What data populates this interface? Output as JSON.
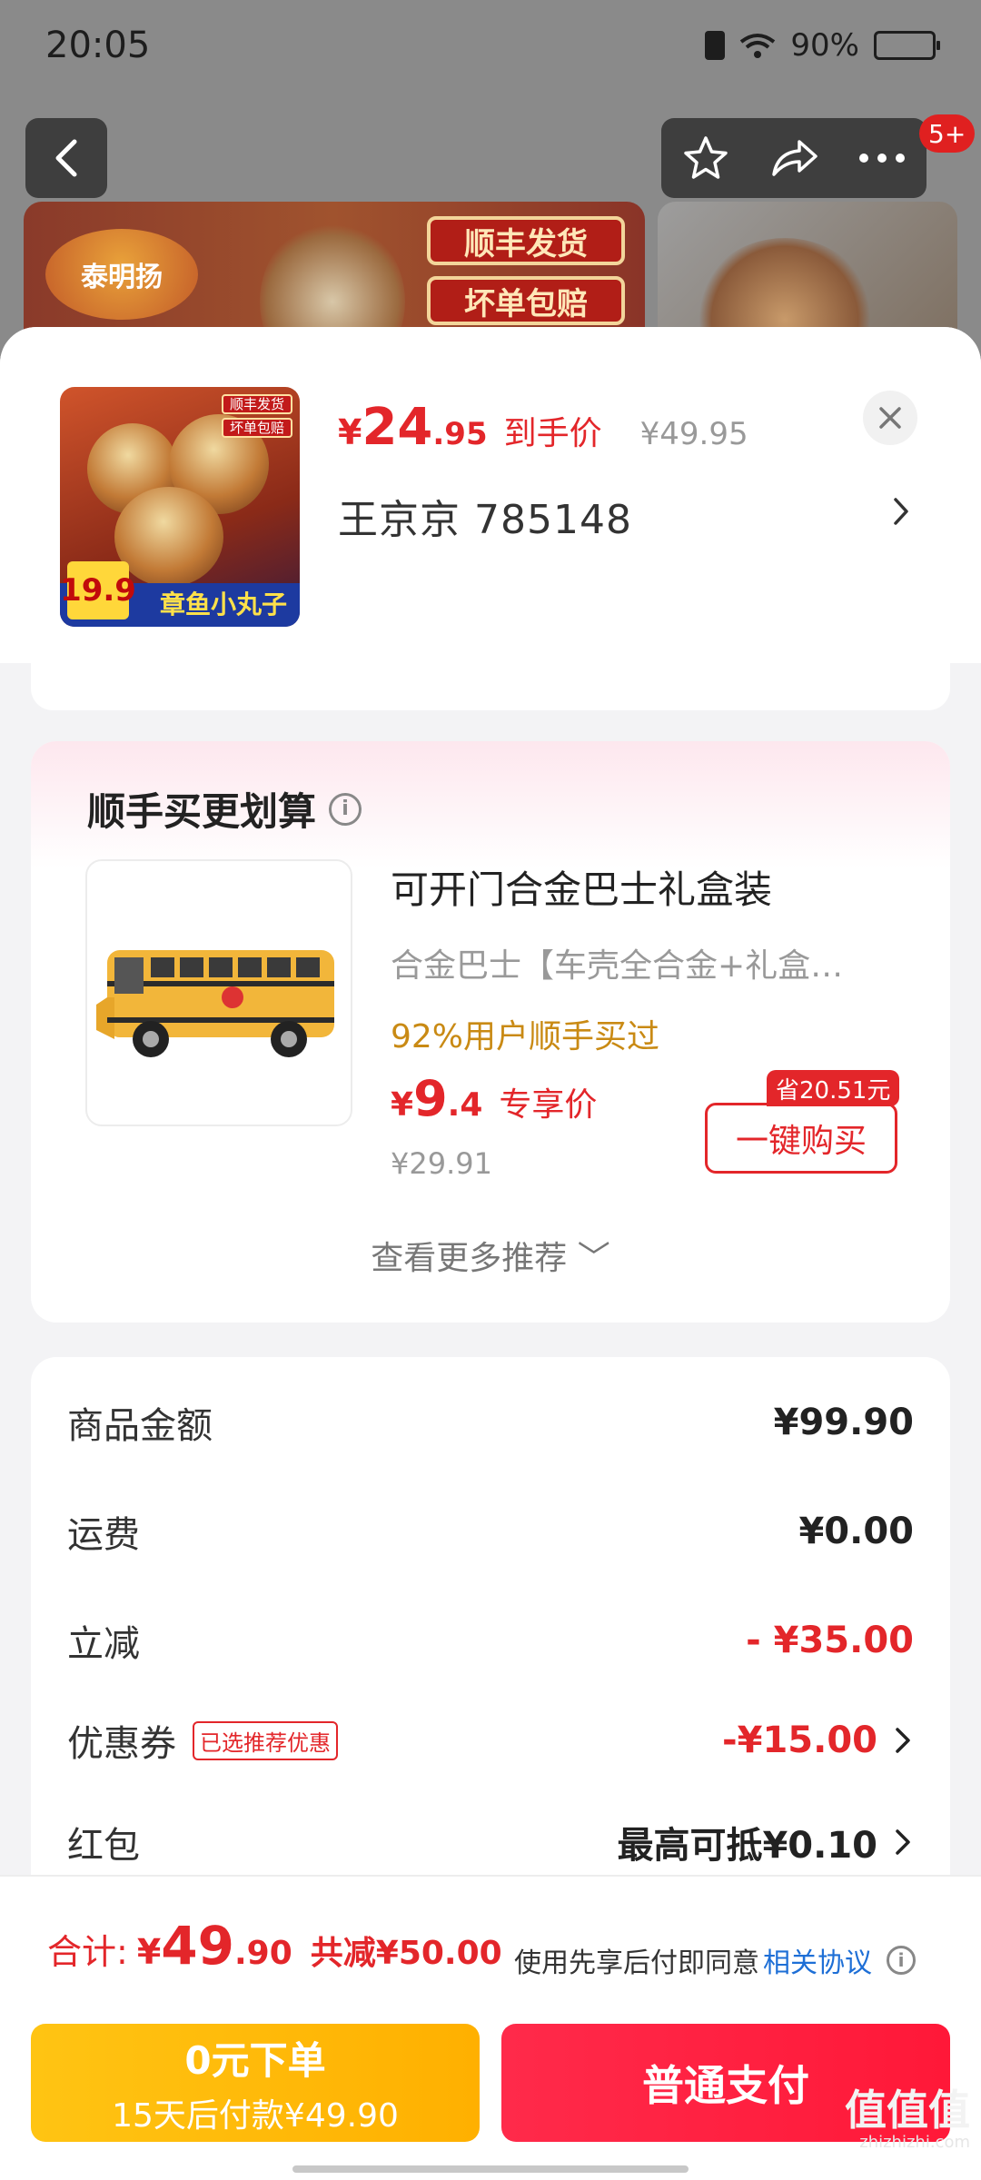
{
  "status_bar": {
    "time": "20:05",
    "battery": "90%"
  },
  "top_nav": {
    "message_badge": "5+"
  },
  "banner": {
    "logo_text": "泰明扬",
    "tag1": "顺丰发货",
    "tag2": "坏单包赔"
  },
  "product": {
    "price_yen": "¥",
    "price_int": "24",
    "price_dec": ".95",
    "price_label": "到手价",
    "original_price": "¥49.95",
    "shop_line": "王京京  785148",
    "thumb_tag1": "顺丰发货",
    "thumb_tag2": "坏单包赔",
    "thumb_caption": "章鱼小丸子",
    "thumb_price": "19.9"
  },
  "recommend": {
    "title": "顺手买更划算",
    "item_name": "可开门合金巴士礼盒装",
    "item_desc": "合金巴士【车壳全合金+礼盒…",
    "stat": "92%用户顺手买过",
    "price_yen": "¥",
    "price_int": "9",
    "price_dec": ".4",
    "price_label": "专享价",
    "original_price": "¥29.91",
    "save_badge": "省20.51元",
    "buy_label": "一键购买",
    "more_label": "查看更多推荐 ﹀"
  },
  "summary": {
    "goods_label": "商品金额",
    "goods_value": "¥99.90",
    "shipping_label": "运费",
    "shipping_value": "¥0.00",
    "discount_label": "立减",
    "discount_value": "- ¥35.00",
    "coupon_label": "优惠券",
    "coupon_tag": "已选推荐优惠",
    "coupon_value": "-¥15.00",
    "redpacket_label": "红包",
    "redpacket_value": "最高可抵¥0.10"
  },
  "bottom": {
    "total_label": "合计:",
    "total_yen": "¥",
    "total_int": "49",
    "total_dec": ".90",
    "total_save": "共减¥50.00",
    "agree_text": "使用先享后付即同意",
    "agree_link": "相关协议",
    "pay_later_main": "0元下单",
    "pay_later_sub": "15天后付款¥49.90",
    "pay_normal": "普通支付"
  },
  "watermark": {
    "main": "值值值",
    "sub": "zhizhizhi.com"
  },
  "colors": {
    "accent_red": "#e3262a",
    "pay_yellow": "#ffc413",
    "link_blue": "#1e6fd6"
  }
}
